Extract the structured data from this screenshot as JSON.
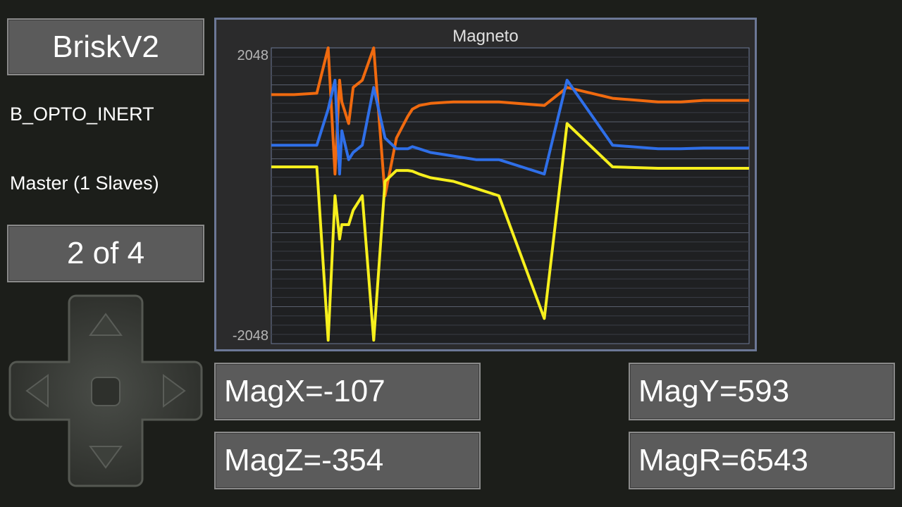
{
  "app": {
    "title": "BriskV2",
    "device": "B_OPTO_INERT",
    "role": "Master (1 Slaves)",
    "page": "2 of 4"
  },
  "readouts": {
    "magx": "MagX=-107",
    "magy": "MagY=593",
    "magz": "MagZ=-354",
    "magr": "MagR=6543"
  },
  "dpad": {
    "buttons": [
      "up-arrow-icon",
      "down-arrow-icon",
      "left-arrow-icon",
      "right-arrow-icon",
      "center-button"
    ]
  },
  "colors": {
    "background": "#1c1e1a",
    "button": "#5b5b5b",
    "chart_frame": "#6c7896",
    "series_orange": "#f06a0f",
    "series_blue": "#2f6fe8",
    "series_yellow": "#f6ef1d"
  },
  "chart_data": {
    "type": "line",
    "title": "Magneto",
    "ylim": [
      -2048,
      2048
    ],
    "y_tick_labels": [
      "2048",
      "-2048"
    ],
    "x": [
      0,
      10,
      20,
      25,
      28,
      30,
      31,
      34,
      36,
      40,
      45,
      50,
      55,
      60,
      62,
      65,
      70,
      80,
      90,
      100,
      120,
      130,
      150,
      170,
      180,
      190,
      200,
      210
    ],
    "series": [
      {
        "color": "#f06a0f",
        "values": [
          1400,
          1400,
          1420,
          2048,
          300,
          1600,
          1300,
          1000,
          1500,
          1600,
          2048,
          0,
          800,
          1100,
          1200,
          1250,
          1280,
          1300,
          1300,
          1300,
          1250,
          1500,
          1350,
          1300,
          1300,
          1320,
          1320,
          1320
        ]
      },
      {
        "color": "#2f6fe8",
        "values": [
          700,
          700,
          700,
          1200,
          1600,
          300,
          900,
          500,
          600,
          700,
          1500,
          800,
          650,
          650,
          680,
          650,
          600,
          550,
          500,
          500,
          300,
          1600,
          700,
          650,
          650,
          660,
          660,
          660
        ]
      },
      {
        "color": "#f6ef1d",
        "values": [
          400,
          400,
          400,
          -2000,
          0,
          -600,
          -400,
          -400,
          -200,
          0,
          -2000,
          200,
          350,
          350,
          340,
          300,
          250,
          200,
          100,
          0,
          -1700,
          1000,
          400,
          380,
          380,
          380,
          380,
          380
        ]
      }
    ]
  }
}
